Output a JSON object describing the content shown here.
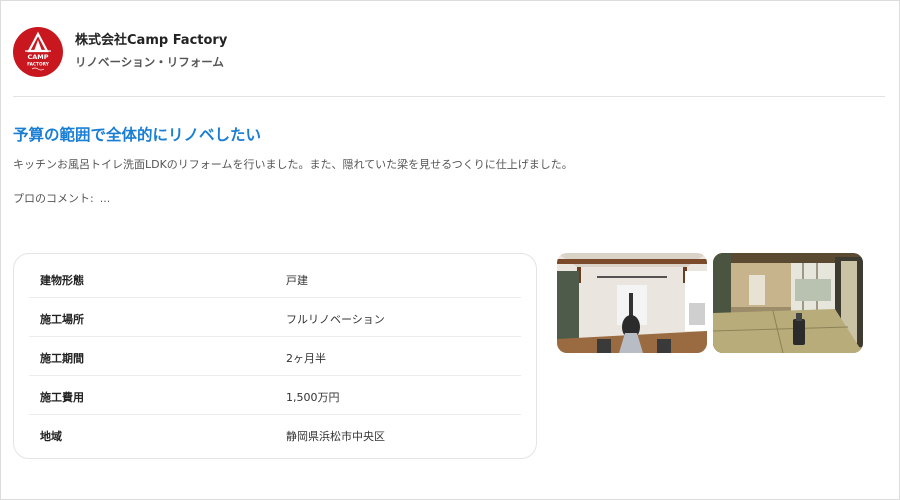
{
  "company": {
    "name": "株式会社Camp Factory",
    "category": "リノベーション・リフォーム",
    "logo": {
      "line1": "CAMP",
      "line2": "FACTORY",
      "bg_color": "#c8171e"
    }
  },
  "case": {
    "title": "予算の範囲で全体的にリノベしたい",
    "description": "キッチンお風呂トイレ洗面LDKのリフォームを行いました。また、隠れていた梁を見せるつくりに仕上げました。",
    "comment_prefix": "プロのコメント:",
    "comment_text": "..."
  },
  "specs": [
    {
      "label": "建物形態",
      "value": "戸建"
    },
    {
      "label": "施工場所",
      "value": "フルリノベーション"
    },
    {
      "label": "施工期間",
      "value": "2ヶ月半"
    },
    {
      "label": "施工費用",
      "value": "1,500万円"
    },
    {
      "label": "地域",
      "value": "静岡県浜松市中央区"
    }
  ],
  "photos": [
    {
      "name": "renovated-living-room-photo"
    },
    {
      "name": "tatami-room-photo"
    }
  ],
  "colors": {
    "accent": "#1a7fd4",
    "brand": "#c8171e"
  }
}
